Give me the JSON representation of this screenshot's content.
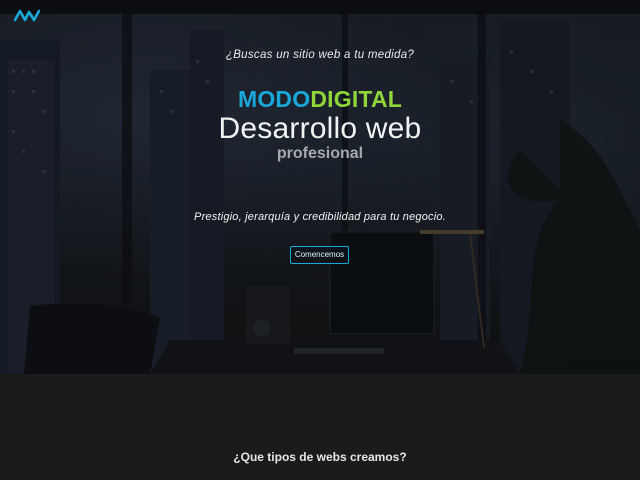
{
  "header": {
    "logo_icon": "modo-digital-logo-icon"
  },
  "hero": {
    "tagline": "¿Buscas un sitio web a tu medida?",
    "brand": {
      "modo": "MODO",
      "digital": "DIGITAL"
    },
    "title": "Desarrollo web",
    "subtitle": "profesional",
    "lead": "Prestigio, jerarquía y credibilidad para tu negocio.",
    "cta_label": "Comencemos"
  },
  "section": {
    "title": "¿Que tipos de webs creamos?"
  },
  "colors": {
    "accent_blue": "#1aa7d9",
    "accent_green": "#8fd63a",
    "background": "#1b1b1b"
  }
}
